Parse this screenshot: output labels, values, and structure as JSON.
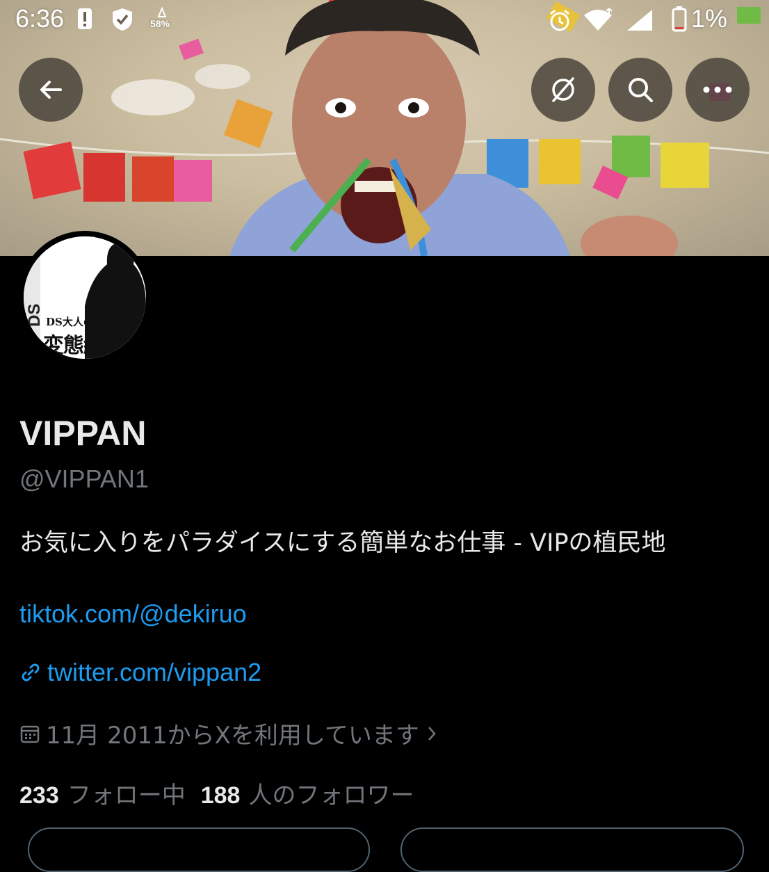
{
  "status_bar": {
    "time": "6:36",
    "notification_badge": "58%",
    "battery": "1%",
    "icons": [
      "alert-icon",
      "shield-check-icon",
      "alarm-icon",
      "wifi-icon",
      "signal-icon",
      "battery-icon"
    ]
  },
  "header_actions": {
    "back": "back-arrow-icon",
    "grok": "slash-circle-icon",
    "search": "search-icon",
    "more": "more-dots-icon"
  },
  "avatar": {
    "caption_small": "DS大人の",
    "caption_big": "変態紳士",
    "side_text": "DS"
  },
  "profile": {
    "display_name": "VIPPAN",
    "handle": "@VIPPAN1",
    "bio": "お気に入りをパラダイスにする簡単なお仕事 - VIPの植民地",
    "bio_link": "tiktok.com/@dekiruo",
    "website": "twitter.com/vippan2",
    "joined": "11月 2011からXを利用しています",
    "following_count": "233",
    "following_label": "フォロー中",
    "followers_count": "188",
    "followers_label": "人のフォロワー"
  },
  "colors": {
    "background": "#000000",
    "text": "#e7e9ea",
    "secondary": "#71767b",
    "link": "#1d9bf0"
  }
}
